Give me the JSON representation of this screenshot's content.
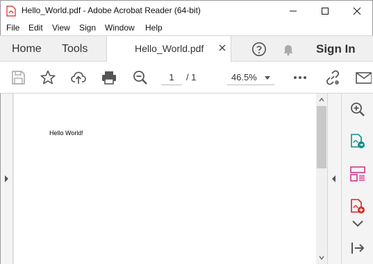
{
  "window": {
    "title": "Hello_World.pdf - Adobe Acrobat Reader (64-bit)"
  },
  "menu": [
    "File",
    "Edit",
    "View",
    "Sign",
    "Window",
    "Help"
  ],
  "tabs": {
    "home": "Home",
    "tools": "Tools",
    "document": "Hello_World.pdf"
  },
  "signin": "Sign In",
  "toolbar": {
    "current_page": "1",
    "page_total": "/ 1",
    "zoom": "46.5%"
  },
  "document": {
    "text": "Hello World!"
  },
  "colors": {
    "accent_red": "#d7262b",
    "teal": "#0f8e8e",
    "pink": "#d6358b",
    "icon_gray": "#555555"
  }
}
